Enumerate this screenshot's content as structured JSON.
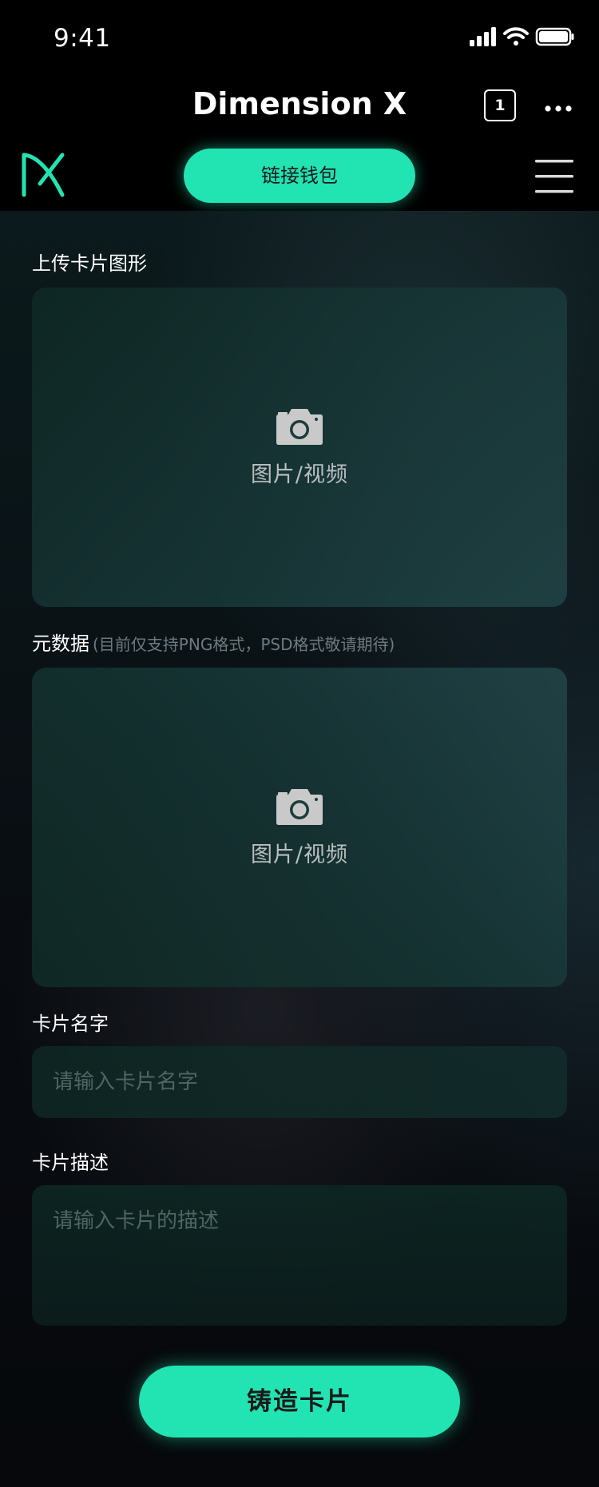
{
  "status_bar": {
    "time": "9:41"
  },
  "nav": {
    "title": "Dimension X",
    "tab_count": "1"
  },
  "header": {
    "connect_wallet_label": "链接钱包"
  },
  "form": {
    "upload_card": {
      "label": "上传卡片图形",
      "placeholder": "图片/视频",
      "icon": "camera-icon"
    },
    "metadata": {
      "label": "元数据",
      "hint": "(目前仅支持PNG格式，PSD格式敬请期待)",
      "placeholder": "图片/视频",
      "icon": "camera-icon"
    },
    "card_name": {
      "label": "卡片名字",
      "placeholder": "请输入卡片名字",
      "value": ""
    },
    "card_description": {
      "label": "卡片描述",
      "placeholder": "请输入卡片的描述",
      "value": ""
    },
    "mint_label": "铸造卡片"
  },
  "colors": {
    "accent": "#22e3b2",
    "background": "#000000"
  }
}
